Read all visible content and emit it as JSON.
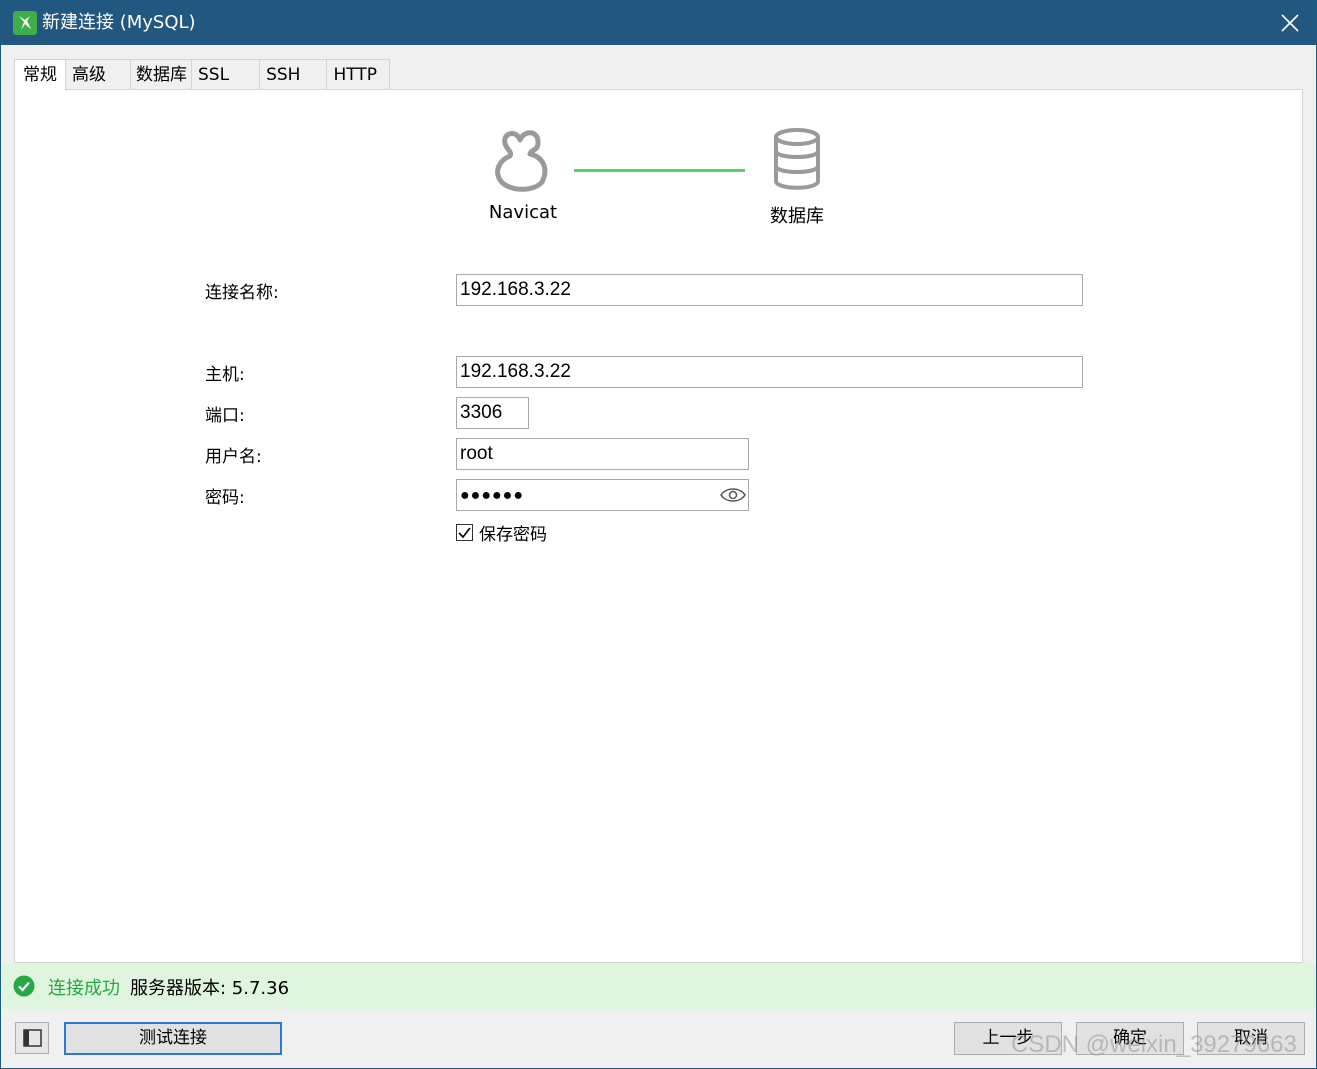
{
  "window": {
    "title": "新建连接 (MySQL)",
    "accent_color": "#22587f"
  },
  "tabs": [
    {
      "label": "常规",
      "active": true
    },
    {
      "label": "高级",
      "active": false
    },
    {
      "label": "数据库",
      "active": false
    },
    {
      "label": "SSL",
      "active": false
    },
    {
      "label": "SSH",
      "active": false
    },
    {
      "label": "HTTP",
      "active": false
    }
  ],
  "diagram": {
    "left_label": "Navicat",
    "right_label": "数据库",
    "line_color": "#5ccf65"
  },
  "form": {
    "connection_name": {
      "label": "连接名称:",
      "value": "192.168.3.22"
    },
    "host": {
      "label": "主机:",
      "value": "192.168.3.22"
    },
    "port": {
      "label": "端口:",
      "value": "3306"
    },
    "username": {
      "label": "用户名:",
      "value": "root"
    },
    "password": {
      "label": "密码:",
      "masked_value": "●●●●●●"
    },
    "save_password": {
      "label": "保存密码",
      "checked": true
    }
  },
  "status": {
    "success_text": "连接成功",
    "version_text": "服务器版本: 5.7.36",
    "success_color": "#28a745"
  },
  "buttons": {
    "test_connection": "测试连接",
    "previous": "上一步",
    "ok": "确定",
    "cancel": "取消"
  },
  "watermark": "CSDN @weixin_39279663"
}
